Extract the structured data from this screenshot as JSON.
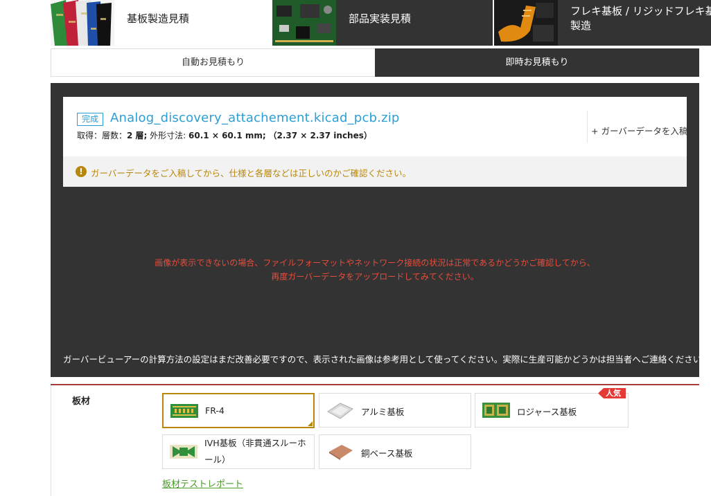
{
  "services": [
    {
      "label": "基板製造見積",
      "icon": "pcb-stack-thumbnail"
    },
    {
      "label": "部品実装見積",
      "icon": "assembled-board-thumbnail"
    },
    {
      "label_line1": "フレキ基板 / リジッドフレキ基板",
      "label_line2": "製造",
      "icon": "flex-pcb-thumbnail"
    }
  ],
  "mode_tabs": {
    "auto": "自動お見積もり",
    "instant": "即時お見積もり"
  },
  "file": {
    "status": "完成",
    "name": "Analog_discovery_attachement.kicad_pcb.zip",
    "meta_prefix": "取得：層数：",
    "layers": "2 層;",
    "dims_label": "外形寸法:",
    "dims_mm": "60.1 × 60.1 mm;",
    "dims_in": "（2.37 × 2.37 inches）",
    "add_gerber": "+ ガーバーデータを入稿",
    "warning": "ガーバーデータをご入稿してから、仕様と各層などは正しいのかご確認ください。"
  },
  "preview": {
    "error_line1": "画像が表示できないの場合、ファイルフォーマットやネットワーク接続の状況は正常であるかどうかご確認してから、",
    "error_line2": "再度ガーバーデータをアップロードしてみてください。",
    "note": "ガーバービューアーの計算方法の設定はまだ改善必要ですので、表示された画像は参考用として使ってください。実際に生産可能かどうかは担当者へご連絡ください。"
  },
  "material": {
    "label": "板材",
    "options": [
      {
        "label": "FR-4",
        "selected": true
      },
      {
        "label": "アルミ基板",
        "selected": false
      },
      {
        "label": "ロジャース基板",
        "selected": false,
        "badge": "人気"
      },
      {
        "label_line1": "IVH基板（非貫通スルーホ",
        "label_line2": "ール）",
        "selected": false
      },
      {
        "label": "銅ベース基板",
        "selected": false
      }
    ],
    "report_link": "板材テストレポート"
  },
  "colors": {
    "accent_blue": "#2a9fd6",
    "warning": "#b8860b",
    "error": "#e74c3c",
    "dark": "#333333",
    "link_green": "#4a9a2b",
    "hot_red": "#e53935"
  }
}
